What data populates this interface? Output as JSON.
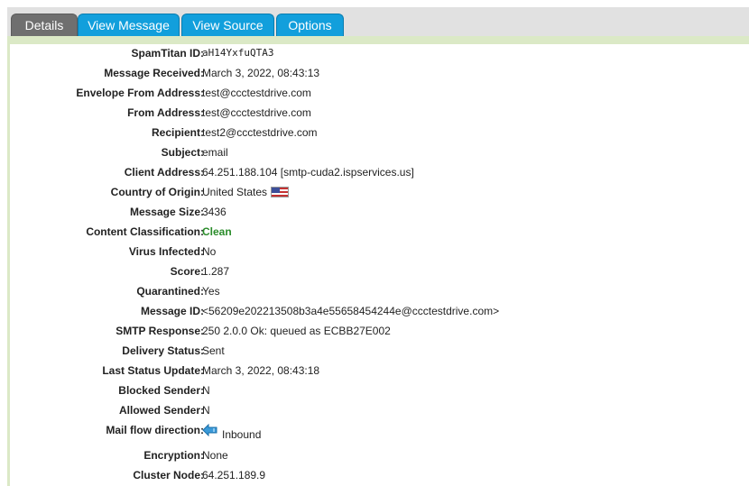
{
  "tabs": {
    "details": "Details",
    "view_message": "View Message",
    "view_source": "View Source",
    "options": "Options"
  },
  "fields": {
    "spamtitan_id": {
      "label": "SpamTitan ID:",
      "value": "aH14YxfuQTA3"
    },
    "message_received": {
      "label": "Message Received:",
      "value": "March 3, 2022, 08:43:13"
    },
    "envelope_from": {
      "label": "Envelope From Address:",
      "value": "test@ccctestdrive.com"
    },
    "from_address": {
      "label": "From Address:",
      "value": "test@ccctestdrive.com"
    },
    "recipient": {
      "label": "Recipient:",
      "value": "test2@ccctestdrive.com"
    },
    "subject": {
      "label": "Subject:",
      "value": "email"
    },
    "client_address": {
      "label": "Client Address:",
      "value": "64.251.188.104 [smtp-cuda2.ispservices.us]"
    },
    "country": {
      "label": "Country of Origin:",
      "value": "United States",
      "flag_icon": "us-flag-icon"
    },
    "message_size": {
      "label": "Message Size:",
      "value": "3436"
    },
    "content_classification": {
      "label": "Content Classification:",
      "value": "Clean",
      "color": "#2a8c2a"
    },
    "virus_infected": {
      "label": "Virus Infected:",
      "value": "No"
    },
    "score": {
      "label": "Score:",
      "value": "1.287"
    },
    "quarantined": {
      "label": "Quarantined:",
      "value": "Yes"
    },
    "message_id": {
      "label": "Message ID:",
      "value": "<56209e202213508b3a4e55658454244e@ccctestdrive.com>"
    },
    "smtp_response": {
      "label": "SMTP Response:",
      "value": "250 2.0.0 Ok: queued as ECBB27E002"
    },
    "delivery_status": {
      "label": "Delivery Status:",
      "value": "Sent"
    },
    "last_status_update": {
      "label": "Last Status Update:",
      "value": "March 3, 2022, 08:43:18"
    },
    "blocked_sender": {
      "label": "Blocked Sender:",
      "value": "N"
    },
    "allowed_sender": {
      "label": "Allowed Sender:",
      "value": "N"
    },
    "mail_flow": {
      "label": "Mail flow direction:",
      "value": "Inbound",
      "icon": "inbound-arrow-icon"
    },
    "encryption": {
      "label": "Encryption:",
      "value": "None"
    },
    "cluster_node": {
      "label": "Cluster Node:",
      "value": "64.251.189.9"
    }
  },
  "colors": {
    "tab_active": "#6f6f6f",
    "tab_blue": "#129fdc",
    "header_band": "#dbe9c6",
    "clean_green": "#2a8c2a"
  }
}
